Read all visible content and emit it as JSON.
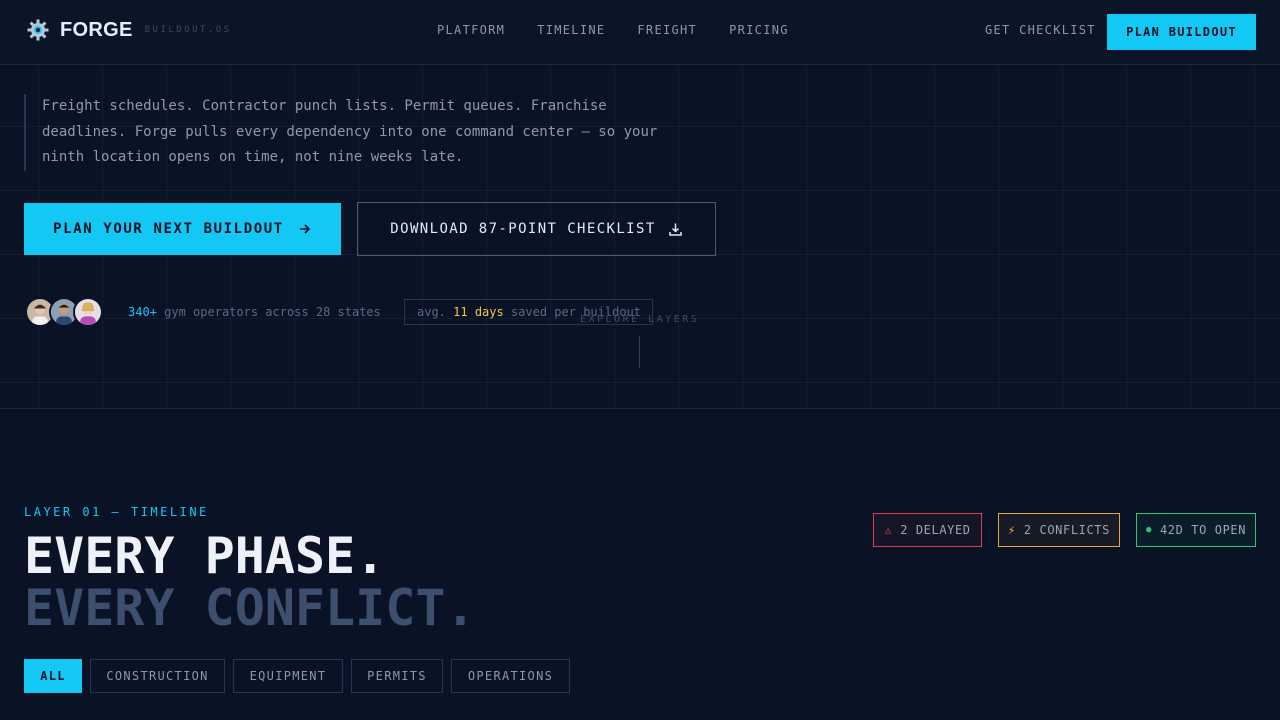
{
  "header": {
    "brand_name": "FORGE",
    "brand_sub": "BUILDOUT.OS",
    "nav": [
      "PLATFORM",
      "TIMELINE",
      "FREIGHT",
      "PRICING"
    ],
    "get_checklist": "GET CHECKLIST",
    "cta": "PLAN BUILDOUT"
  },
  "hero": {
    "quote": "Freight schedules. Contractor punch lists. Permit queues. Franchise deadlines. Forge pulls every dependency into one command center — so your ninth location opens on time, not nine weeks late.",
    "primary_button": "PLAN YOUR NEXT BUILDOUT",
    "secondary_button": "DOWNLOAD 87-POINT CHECKLIST",
    "stat_operators_count": "340+",
    "stat_operators_text": "gym operators across 28 states",
    "stat_saved_prefix": "avg.",
    "stat_saved_value": "11 days",
    "stat_saved_suffix": "saved per buildout",
    "explore": "EXPLORE LAYERS"
  },
  "layer": {
    "label": "LAYER 01 — TIMELINE",
    "headline_1": "EVERY PHASE.",
    "headline_2": "EVERY CONFLICT.",
    "badges": {
      "delayed": "2 DELAYED",
      "conflicts": "2 CONFLICTS",
      "open": "42D TO OPEN"
    },
    "filters": [
      "ALL",
      "CONSTRUCTION",
      "EQUIPMENT",
      "PERMITS",
      "OPERATIONS"
    ]
  },
  "colors": {
    "accent": "#14c8f5",
    "background": "#0a1326",
    "danger": "#e5484d",
    "warning": "#f5c542",
    "success": "#2fc47a"
  },
  "icons": {
    "brand": "gear-logo-icon",
    "arrow": "arrow-right-icon",
    "download": "download-icon",
    "delayed": "warning-triangle-icon",
    "conflicts": "lightning-icon",
    "open": "status-dot-icon"
  }
}
